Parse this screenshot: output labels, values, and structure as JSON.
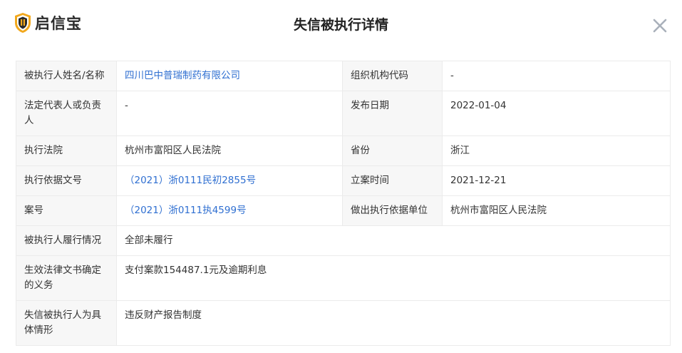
{
  "header": {
    "logo_text": "启信宝",
    "title": "失信被执行详情",
    "close_icon": "close-icon"
  },
  "colors": {
    "logo_shield": "#f2a81d",
    "link": "#2f6fd1",
    "label_bg": "#f7f7f7",
    "border": "#ebebeb",
    "close_icon": "#a9b0ba"
  },
  "details": {
    "debtor_name_label": "被执行人姓名/名称",
    "debtor_name_value": "四川巴中普瑞制药有限公司",
    "org_code_label": "组织机构代码",
    "org_code_value": "-",
    "legal_rep_label": "法定代表人或负责人",
    "legal_rep_value": "-",
    "publish_date_label": "发布日期",
    "publish_date_value": "2022-01-04",
    "court_label": "执行法院",
    "court_value": "杭州市富阳区人民法院",
    "province_label": "省份",
    "province_value": "浙江",
    "basis_doc_label": "执行依据文号",
    "basis_doc_value": "（2021）浙0111民初2855号",
    "filing_date_label": "立案时间",
    "filing_date_value": "2021-12-21",
    "case_no_label": "案号",
    "case_no_value": "（2021）浙0111执4599号",
    "basis_unit_label": "做出执行依据单位",
    "basis_unit_value": "杭州市富阳区人民法院",
    "performance_label": "被执行人履行情况",
    "performance_value": "全部未履行",
    "obligation_label": "生效法律文书确定的义务",
    "obligation_value": "支付案款154487.1元及逾期利息",
    "situation_label": "失信被执行人为具体情形",
    "situation_value": "违反财产报告制度"
  }
}
